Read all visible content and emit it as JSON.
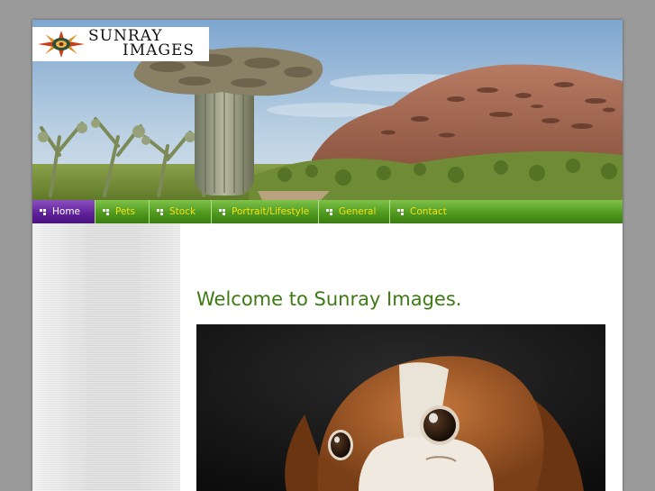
{
  "logo": {
    "line1": "SUNRAY",
    "line2": "IMAGES"
  },
  "nav": {
    "items": [
      {
        "label": "Home",
        "active": true
      },
      {
        "label": "Pets",
        "active": false
      },
      {
        "label": "Stock",
        "active": false
      },
      {
        "label": "Portrait/Lifestyle",
        "active": false
      },
      {
        "label": "General",
        "active": false
      },
      {
        "label": "Contact",
        "active": false
      }
    ]
  },
  "content": {
    "heading": "Welcome to Sunray Images."
  },
  "colors": {
    "nav_green": "#5aa82a",
    "nav_active": "#6a2aa6",
    "nav_text": "#f2e218",
    "heading": "#3d7a14"
  },
  "icons": {
    "logo": "sunburst-logo-icon",
    "nav": "nav-bullet-icon"
  }
}
